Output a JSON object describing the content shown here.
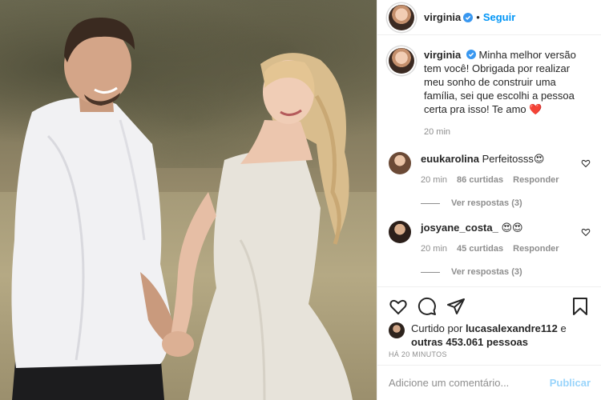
{
  "header": {
    "username": "virginia",
    "follow_label": "Seguir",
    "separator": "•"
  },
  "caption": {
    "username": "virginia",
    "text": "Minha melhor versão tem você! Obrigada por realizar meu sonho de construir uma família, sei que escolhi a pessoa certa pra isso! Te amo",
    "emoji": "❤️",
    "time": "20 min"
  },
  "comments": [
    {
      "username": "euukarolina",
      "text": "Perfeitosss",
      "emoji": "😍",
      "time": "20 min",
      "likes": "86 curtidas",
      "reply_label": "Responder",
      "replies_label": "Ver respostas (3)"
    },
    {
      "username": "josyane_costa_",
      "text": "",
      "emoji": "😍😍",
      "time": "20 min",
      "likes": "45 curtidas",
      "reply_label": "Responder",
      "replies_label": "Ver respostas (3)"
    }
  ],
  "actions": {
    "icons": [
      "heart-icon",
      "comment-icon",
      "share-icon",
      "bookmark-icon"
    ]
  },
  "likes": {
    "prefix": "Curtido por",
    "user": "lucasalexandre112",
    "middle": "e",
    "others": "outras 453.061 pessoas"
  },
  "timestamp": "HÁ 20 MINUTOS",
  "add_comment": {
    "placeholder": "Adicione um comentário...",
    "post_label": "Publicar"
  },
  "colors": {
    "accent": "#0095f6",
    "heart": "#ed4956",
    "muted": "#8e8e8e",
    "border": "#efefef"
  }
}
